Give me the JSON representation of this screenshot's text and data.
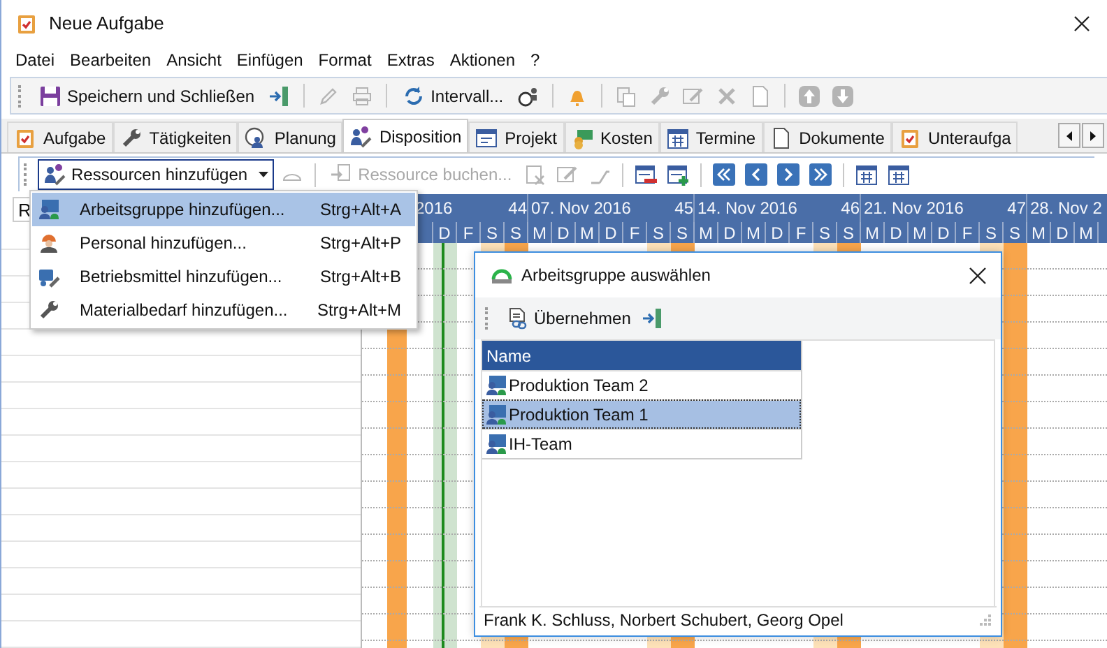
{
  "window": {
    "title": "Neue Aufgabe"
  },
  "menu_bar": [
    "Datei",
    "Bearbeiten",
    "Ansicht",
    "Einfügen",
    "Format",
    "Extras",
    "Aktionen",
    "?"
  ],
  "toolbar": [
    {
      "kind": "button",
      "label": "Speichern und Schließen",
      "disabled": false
    },
    {
      "kind": "icon",
      "disabled": false
    },
    {
      "kind": "separator"
    },
    {
      "kind": "icon",
      "disabled": true
    },
    {
      "kind": "icon",
      "disabled": true
    },
    {
      "kind": "separator"
    },
    {
      "kind": "button",
      "label": "Intervall...",
      "disabled": false
    },
    {
      "kind": "icon",
      "disabled": false
    },
    {
      "kind": "separator"
    },
    {
      "kind": "icon",
      "disabled": false
    },
    {
      "kind": "separator"
    },
    {
      "kind": "icon",
      "disabled": true
    },
    {
      "kind": "icon",
      "disabled": true
    },
    {
      "kind": "icon",
      "disabled": true
    },
    {
      "kind": "icon",
      "disabled": true
    },
    {
      "kind": "icon",
      "disabled": true
    },
    {
      "kind": "separator"
    },
    {
      "kind": "icon",
      "disabled": true
    },
    {
      "kind": "icon",
      "disabled": true
    }
  ],
  "tabs": [
    {
      "label": "Aufgabe",
      "selected": false
    },
    {
      "label": "Tätigkeiten",
      "selected": false
    },
    {
      "label": "Planung",
      "selected": false
    },
    {
      "label": "Disposition",
      "selected": true
    },
    {
      "label": "Projekt",
      "selected": false
    },
    {
      "label": "Kosten",
      "selected": false
    },
    {
      "label": "Termine",
      "selected": false
    },
    {
      "label": "Dokumente",
      "selected": false
    },
    {
      "label": "Unteraufga",
      "selected": false
    }
  ],
  "disposition_toolbar": [
    {
      "kind": "menu-button",
      "label": "Ressourcen hinzufügen",
      "expanded": true
    },
    {
      "kind": "icon",
      "disabled": true
    },
    {
      "kind": "separator"
    },
    {
      "kind": "button",
      "label": "Ressource buchen...",
      "disabled": true
    },
    {
      "kind": "icon",
      "disabled": true
    },
    {
      "kind": "icon",
      "disabled": true
    },
    {
      "kind": "icon",
      "disabled": true
    },
    {
      "kind": "separator"
    },
    {
      "kind": "icon",
      "disabled": false
    },
    {
      "kind": "icon",
      "disabled": false
    },
    {
      "kind": "separator"
    },
    {
      "kind": "icon",
      "disabled": false
    },
    {
      "kind": "icon",
      "disabled": false
    },
    {
      "kind": "icon",
      "disabled": false
    },
    {
      "kind": "icon",
      "disabled": false
    },
    {
      "kind": "separator"
    },
    {
      "kind": "icon",
      "disabled": false
    },
    {
      "kind": "icon",
      "disabled": false
    }
  ],
  "resource_list": {
    "column_header": "R"
  },
  "timeline": {
    "weeks": [
      {
        "label": "2016",
        "number": "44",
        "days": [
          {
            "kind": "workday"
          },
          {
            "kind": "holiday"
          },
          {
            "kind": "workday"
          },
          {
            "letter": "D",
            "kind": "today"
          },
          {
            "letter": "F",
            "kind": "workday"
          },
          {
            "letter": "S",
            "kind": "saturday"
          },
          {
            "letter": "S",
            "kind": "sunday"
          }
        ]
      },
      {
        "label": "07. Nov 2016",
        "number": "45",
        "days": [
          {
            "letter": "M",
            "kind": "workday"
          },
          {
            "letter": "D",
            "kind": "workday"
          },
          {
            "letter": "M",
            "kind": "workday"
          },
          {
            "letter": "D",
            "kind": "workday"
          },
          {
            "letter": "F",
            "kind": "workday"
          },
          {
            "letter": "S",
            "kind": "saturday"
          },
          {
            "letter": "S",
            "kind": "sunday"
          }
        ]
      },
      {
        "label": "14. Nov 2016",
        "number": "46",
        "days": [
          {
            "letter": "M",
            "kind": "workday"
          },
          {
            "letter": "D",
            "kind": "workday"
          },
          {
            "letter": "M",
            "kind": "workday"
          },
          {
            "letter": "D",
            "kind": "workday"
          },
          {
            "letter": "F",
            "kind": "workday"
          },
          {
            "letter": "S",
            "kind": "saturday"
          },
          {
            "letter": "S",
            "kind": "sunday"
          }
        ]
      },
      {
        "label": "21. Nov 2016",
        "number": "47",
        "days": [
          {
            "letter": "M",
            "kind": "workday"
          },
          {
            "letter": "D",
            "kind": "workday"
          },
          {
            "letter": "M",
            "kind": "workday"
          },
          {
            "letter": "D",
            "kind": "workday"
          },
          {
            "letter": "F",
            "kind": "workday"
          },
          {
            "letter": "S",
            "kind": "saturday"
          },
          {
            "letter": "S",
            "kind": "sunday"
          }
        ]
      },
      {
        "label": "28. Nov 2",
        "days": [
          {
            "letter": "M",
            "kind": "workday"
          },
          {
            "letter": "D",
            "kind": "workday"
          },
          {
            "letter": "M",
            "kind": "workday"
          }
        ]
      }
    ]
  },
  "add_menu": {
    "items": [
      {
        "label": "Arbeitsgruppe hinzufügen...",
        "shortcut": "Strg+Alt+A",
        "selected": true
      },
      {
        "label": "Personal hinzufügen...",
        "shortcut": "Strg+Alt+P",
        "selected": false
      },
      {
        "label": "Betriebsmittel hinzufügen...",
        "shortcut": "Strg+Alt+B",
        "selected": false
      },
      {
        "label": "Materialbedarf hinzufügen...",
        "shortcut": "Strg+Alt+M",
        "selected": false
      }
    ]
  },
  "dialog": {
    "title": "Arbeitsgruppe auswählen",
    "accept_button": "Übernehmen",
    "table": {
      "columns": [
        "Name"
      ],
      "rows": [
        {
          "name": "Produktion Team 2",
          "selected": false
        },
        {
          "name": "Produktion Team 1",
          "selected": true
        },
        {
          "name": "IH-Team",
          "selected": false
        }
      ]
    },
    "status": "Frank K. Schluss, Norbert Schubert, Georg Opel"
  }
}
